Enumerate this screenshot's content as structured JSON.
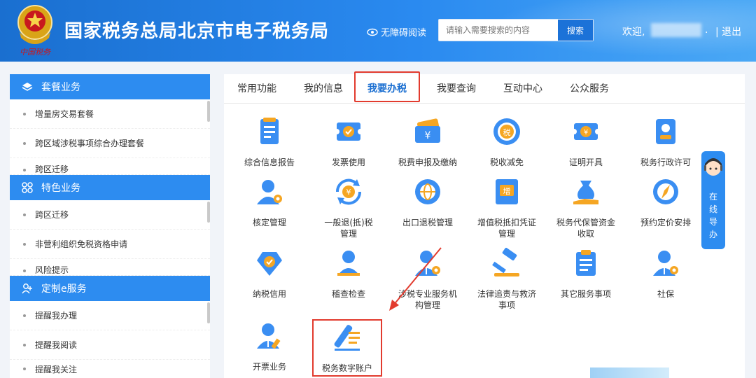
{
  "header": {
    "site_title": "国家税务总局北京市电子税务局",
    "accessibility_label": "无障碍阅读",
    "search_placeholder": "请输入需要搜索的内容",
    "search_button": "搜索",
    "welcome": "欢迎,",
    "separator": ".",
    "logout": "| 退出"
  },
  "sidebar": {
    "sections": [
      {
        "title": "套餐业务",
        "items": [
          "增量房交易套餐",
          "跨区域涉税事项综合办理套餐",
          "跨区迁移"
        ]
      },
      {
        "title": "特色业务",
        "items": [
          "跨区迁移",
          "非营利组织免税资格申请",
          "风险提示"
        ]
      },
      {
        "title": "定制e服务",
        "items": [
          "提醒我办理",
          "提醒我阅读",
          "提醒我关注"
        ]
      }
    ]
  },
  "tabs": [
    "常用功能",
    "我的信息",
    "我要办税",
    "我要查询",
    "互动中心",
    "公众服务"
  ],
  "tiles": [
    {
      "line1": "综合信息报告",
      "line2": "",
      "icon": "report-icon"
    },
    {
      "line1": "发票使用",
      "line2": "",
      "icon": "invoice-icon"
    },
    {
      "line1": "税费申报及缴纳",
      "line2": "",
      "icon": "tax-payment-icon"
    },
    {
      "line1": "税收减免",
      "line2": "",
      "icon": "tax-relief-icon"
    },
    {
      "line1": "证明开具",
      "line2": "",
      "icon": "certificate-icon"
    },
    {
      "line1": "税务行政许可",
      "line2": "",
      "icon": "admin-license-icon"
    },
    {
      "line1": "核定管理",
      "line2": "",
      "icon": "user-gear-icon"
    },
    {
      "line1": "一般退(抵)税",
      "line2": "管理",
      "icon": "refund-icon"
    },
    {
      "line1": "出口退税管理",
      "line2": "",
      "icon": "export-globe-icon"
    },
    {
      "line1": "增值税抵扣凭证",
      "line2": "管理",
      "icon": "vat-ticket-icon"
    },
    {
      "line1": "税务代保管资金",
      "line2": "收取",
      "icon": "money-bag-icon"
    },
    {
      "line1": "预约定价安排",
      "line2": "",
      "icon": "compass-icon"
    },
    {
      "line1": "纳税信用",
      "line2": "",
      "icon": "credit-diamond-icon"
    },
    {
      "line1": "稽查检查",
      "line2": "",
      "icon": "inspector-icon"
    },
    {
      "line1": "涉税专业服务机",
      "line2": "构管理",
      "icon": "agency-icon"
    },
    {
      "line1": "法律追责与救济",
      "line2": "事项",
      "icon": "gavel-icon"
    },
    {
      "line1": "其它服务事项",
      "line2": "",
      "icon": "clipboard-icon"
    },
    {
      "line1": "社保",
      "line2": "",
      "icon": "social-security-icon"
    },
    {
      "line1": "开票业务",
      "line2": "",
      "icon": "issue-invoice-icon"
    },
    {
      "line1": "税务数字账户",
      "line2": "",
      "icon": "digital-account-icon"
    }
  ],
  "guide": {
    "lines": [
      "在",
      "线",
      "导",
      "办"
    ]
  },
  "colors": {
    "primary": "#2d8cf0",
    "header": "#1a6fd0",
    "highlight": "#e23b2e",
    "accent_orange": "#f5a623"
  }
}
